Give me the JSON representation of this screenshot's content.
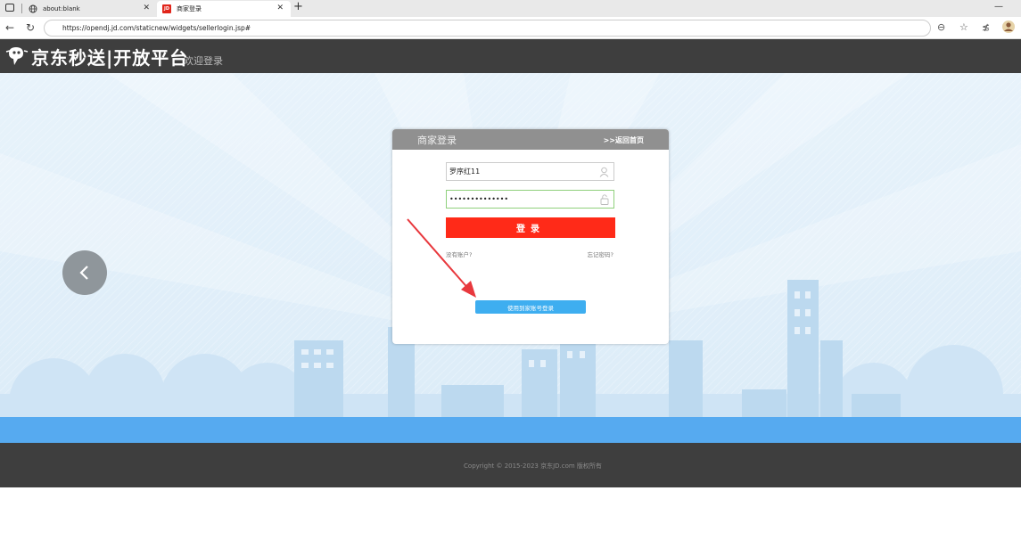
{
  "browser": {
    "tabs": [
      {
        "title": "about:blank",
        "icon": "globe-icon"
      },
      {
        "title": "商家登录",
        "icon": "jd-favicon",
        "favicon_text": "JD"
      }
    ],
    "url": "https://opendj.jd.com/staticnew/widgets/sellerlogin.jsp#"
  },
  "header": {
    "logo_text": "京东秒送|开放平台",
    "welcome": "欢迎登录"
  },
  "login": {
    "title": "商家登录",
    "back_home": ">>返回首页",
    "username_value": "罗序红11",
    "password_value": "••••••••••••••",
    "login_button": "登录",
    "no_account": "没有账户?",
    "forgot_password": "忘记密码?",
    "daojia_login": "使用到家账号登录"
  },
  "footer": {
    "copyright": "Copyright © 2015-2023 京东JD.com 版权所有"
  },
  "colors": {
    "header_bg": "#3e3e3e",
    "login_red": "#ff2a18",
    "accent_blue": "#3eaef0",
    "band_blue": "#56aaf0",
    "annotation_arrow": "#e8383d"
  }
}
